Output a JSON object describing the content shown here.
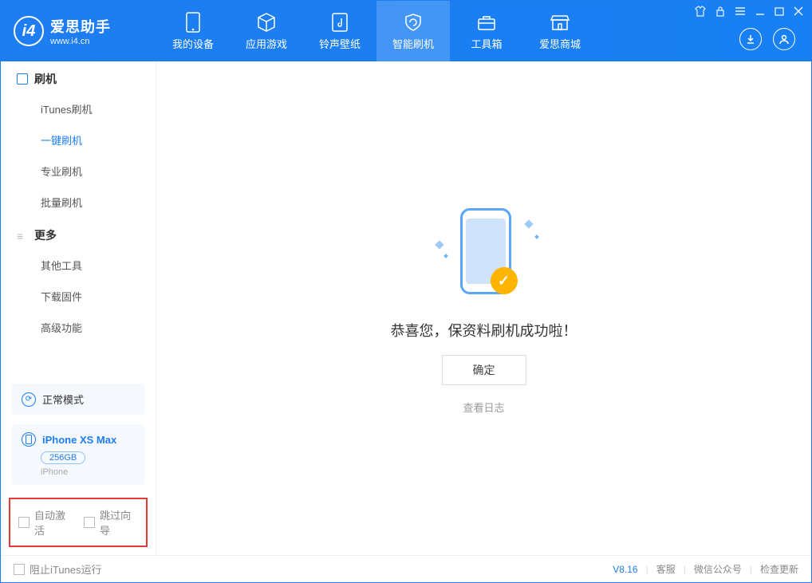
{
  "header": {
    "app_title": "爱思助手",
    "app_url": "www.i4.cn",
    "tabs": [
      {
        "label": "我的设备"
      },
      {
        "label": "应用游戏"
      },
      {
        "label": "铃声壁纸"
      },
      {
        "label": "智能刷机"
      },
      {
        "label": "工具箱"
      },
      {
        "label": "爱思商城"
      }
    ]
  },
  "sidebar": {
    "section1_title": "刷机",
    "section1_items": [
      "iTunes刷机",
      "一键刷机",
      "专业刷机",
      "批量刷机"
    ],
    "section2_title": "更多",
    "section2_items": [
      "其他工具",
      "下载固件",
      "高级功能"
    ],
    "status_mode": "正常模式",
    "device_name": "iPhone XS Max",
    "device_storage": "256GB",
    "device_type": "iPhone",
    "check_auto_activate": "自动激活",
    "check_skip_guide": "跳过向导"
  },
  "main": {
    "result_text": "恭喜您，保资料刷机成功啦！",
    "ok_button": "确定",
    "view_log": "查看日志"
  },
  "footer": {
    "prevent_itunes": "阻止iTunes运行",
    "version": "V8.16",
    "support": "客服",
    "wechat": "微信公众号",
    "update": "检查更新"
  }
}
